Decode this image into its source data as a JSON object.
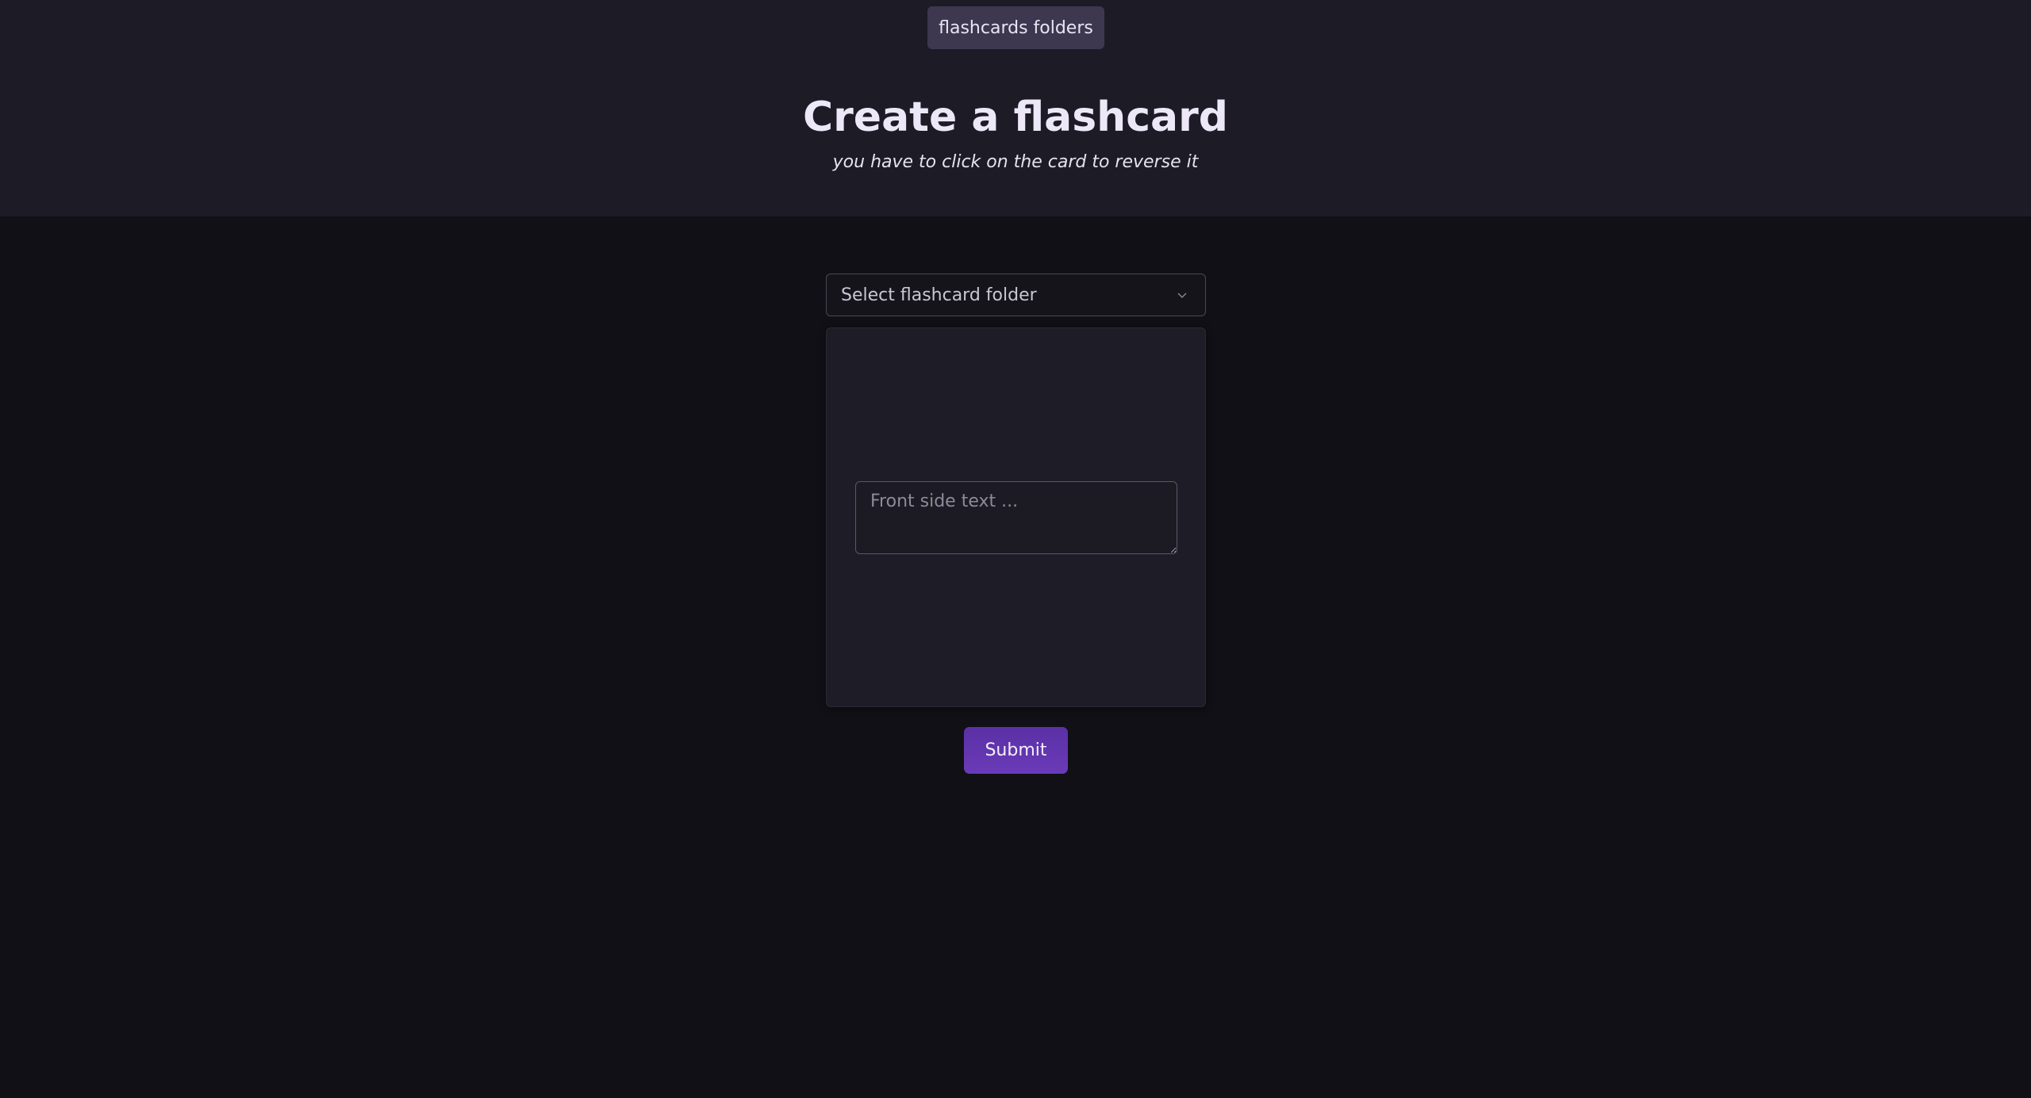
{
  "nav": {
    "folders_label": "flashcards folders"
  },
  "header": {
    "title": "Create a flashcard",
    "subtitle": "you have to click on the card to reverse it"
  },
  "form": {
    "folder_select": {
      "selected_text": "Select flashcard folder",
      "icon": "chevron-down-icon"
    },
    "card": {
      "front_placeholder": "Front side text ...",
      "front_value": ""
    },
    "submit_label": "Submit"
  },
  "colors": {
    "header_background": "#1d1b26",
    "page_background": "#111016",
    "accent": "#5a30a5"
  }
}
